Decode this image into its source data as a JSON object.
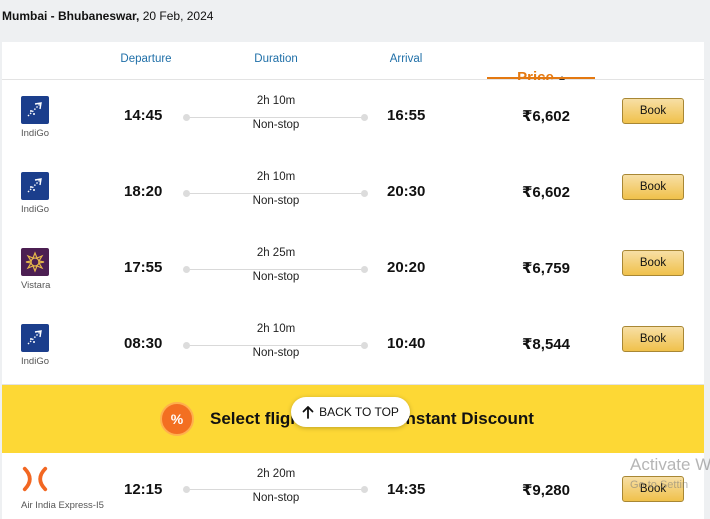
{
  "route": {
    "cities": "Mumbai - Bhubaneswar,",
    "date": "20 Feb, 2024"
  },
  "headers": {
    "departure": "Departure",
    "duration": "Duration",
    "arrival": "Arrival",
    "price": "Price",
    "sort_icon": "caret-up-icon"
  },
  "flights": [
    {
      "airline": "IndiGo",
      "logo_icon": "indigo-logo-icon",
      "dep": "14:45",
      "duration": "2h 10m",
      "stops": "Non-stop",
      "arr": "16:55",
      "price": "₹6,602",
      "book": "Book"
    },
    {
      "airline": "IndiGo",
      "logo_icon": "indigo-logo-icon",
      "dep": "18:20",
      "duration": "2h 10m",
      "stops": "Non-stop",
      "arr": "20:30",
      "price": "₹6,602",
      "book": "Book"
    },
    {
      "airline": "Vistara",
      "logo_icon": "vistara-logo-icon",
      "dep": "17:55",
      "duration": "2h 25m",
      "stops": "Non-stop",
      "arr": "20:20",
      "price": "₹6,759",
      "book": "Book"
    },
    {
      "airline": "IndiGo",
      "logo_icon": "indigo-logo-icon",
      "dep": "08:30",
      "duration": "2h 10m",
      "stops": "Non-stop",
      "arr": "10:40",
      "price": "₹8,544",
      "book": "Book"
    }
  ],
  "banner": {
    "badge": "%",
    "text": "Select flights to unlock Instant Discount"
  },
  "flight5": {
    "airline": "Air India Express-I5",
    "logo_icon": "air-india-express-logo-icon",
    "dep": "12:15",
    "duration": "2h 20m",
    "stops": "Non-stop",
    "arr": "14:35",
    "price": "₹9,280",
    "book": "Book"
  },
  "back_to_top": {
    "label": "BACK TO TOP"
  },
  "watermark": {
    "line1": "Activate W",
    "line2": "Go to Settin"
  },
  "colors": {
    "accent_link": "#1f6fa8",
    "price_accent": "#e47911",
    "banner": "#fdd835",
    "book_button": "#f0c14b"
  }
}
